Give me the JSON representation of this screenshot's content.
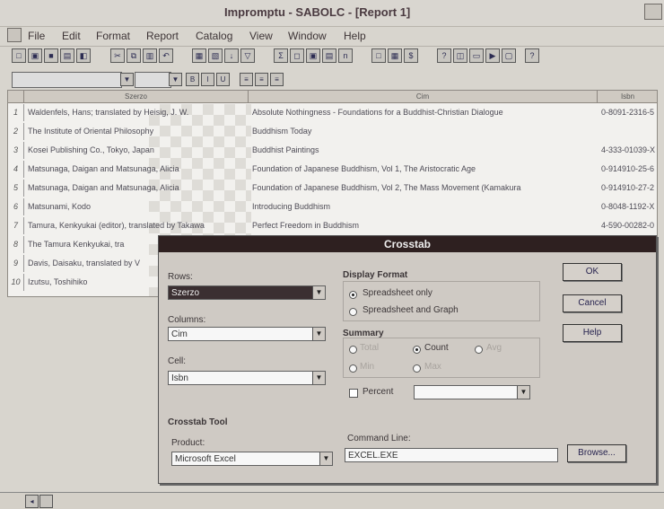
{
  "window": {
    "title": "Impromptu - SABOLC - [Report 1]"
  },
  "menu": {
    "items": [
      "File",
      "Edit",
      "Format",
      "Report",
      "Catalog",
      "View",
      "Window",
      "Help"
    ]
  },
  "toolbar": {
    "icons": [
      "new",
      "open",
      "save",
      "print",
      "preview",
      "cut",
      "copy",
      "paste",
      "undo",
      "sort",
      "filter",
      "group",
      "sum",
      "query",
      "form",
      "chart",
      "crosstab",
      "text",
      "picture",
      "help"
    ]
  },
  "grid": {
    "columns": [
      "Szerzo",
      "Cim",
      "Isbn"
    ],
    "row_numbers": [
      "1",
      "2",
      "3",
      "4",
      "5",
      "6",
      "7",
      "8",
      "9",
      "10"
    ],
    "rows": [
      {
        "szerzo": "Waldenfels, Hans; translated by Heisig, J. W.",
        "cim": "Absolute Nothingness - Foundations for a Buddhist-Christian Dialogue",
        "isbn": "0-8091-2316-5"
      },
      {
        "szerzo": "The Institute of Oriental Philosophy",
        "cim": "Buddhism Today",
        "isbn": ""
      },
      {
        "szerzo": "Kosei Publishing Co., Tokyo, Japan",
        "cim": "Buddhist Paintings",
        "isbn": "4-333-01039-X"
      },
      {
        "szerzo": "Matsunaga, Daigan and Matsunaga, Alicia",
        "cim": "Foundation of Japanese Buddhism, Vol 1, The Aristocratic Age",
        "isbn": "0-914910-25-6"
      },
      {
        "szerzo": "Matsunaga, Daigan and Matsunaga, Alicia",
        "cim": "Foundation of Japanese Buddhism, Vol 2, The Mass Movement (Kamakura",
        "isbn": "0-914910-27-2"
      },
      {
        "szerzo": "Matsunami, Kodo",
        "cim": "Introducing Buddhism",
        "isbn": "0-8048-1192-X"
      },
      {
        "szerzo": "Tamura, Kenkyukai (editor), translated by Takawa",
        "cim": "Perfect Freedom in Buddhism",
        "isbn": "4-590-00282-0"
      },
      {
        "szerzo": "The Tamura Kenkyukai, tra",
        "cim": "",
        "isbn": "034-6"
      },
      {
        "szerzo": "Davis, Daisaku, translated by V",
        "cim": "",
        "isbn": "201-2"
      },
      {
        "szerzo": "Izutsu, Toshihiko",
        "cim": "",
        "isbn": "737-4"
      }
    ]
  },
  "dialog": {
    "title": "Crosstab",
    "rows_label": "Rows:",
    "rows_value": "Szerzo",
    "columns_label": "Columns:",
    "columns_value": "Cim",
    "cell_label": "Cell:",
    "cell_value": "Isbn",
    "display_format_label": "Display Format",
    "spreadsheet_only": "Spreadsheet only",
    "spreadsheet_graph": "Spreadsheet and Graph",
    "summary_label": "Summary",
    "summary_total": "Total",
    "summary_count": "Count",
    "summary_avg": "Avg",
    "summary_min": "Min",
    "summary_max": "Max",
    "percent_label": "Percent",
    "crosstab_tool_label": "Crosstab Tool",
    "product_label": "Product:",
    "product_value": "Microsoft Excel",
    "command_line_label": "Command Line:",
    "command_line_value": "EXCEL.EXE",
    "ok": "OK",
    "cancel": "Cancel",
    "help": "Help",
    "browse": "Browse..."
  }
}
